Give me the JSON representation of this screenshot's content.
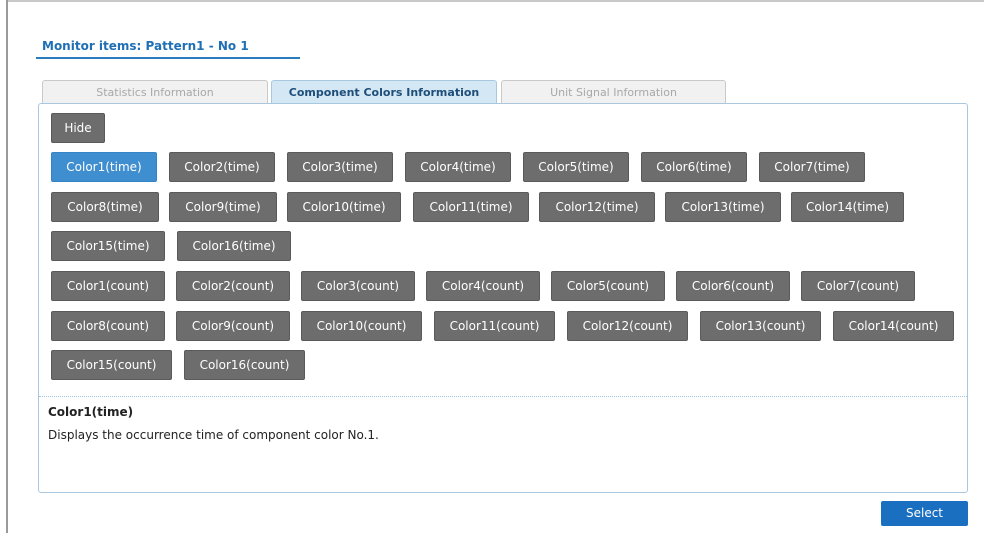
{
  "header": {
    "title": "Monitor items: Pattern1 - No 1"
  },
  "tabs": [
    {
      "label": "Statistics Information",
      "active": false
    },
    {
      "label": "Component Colors Information",
      "active": true
    },
    {
      "label": "Unit Signal Information",
      "active": false
    }
  ],
  "buttons": {
    "hide": "Hide",
    "time": [
      "Color1(time)",
      "Color2(time)",
      "Color3(time)",
      "Color4(time)",
      "Color5(time)",
      "Color6(time)",
      "Color7(time)",
      "Color8(time)",
      "Color9(time)",
      "Color10(time)",
      "Color11(time)",
      "Color12(time)",
      "Color13(time)",
      "Color14(time)",
      "Color15(time)",
      "Color16(time)"
    ],
    "count": [
      "Color1(count)",
      "Color2(count)",
      "Color3(count)",
      "Color4(count)",
      "Color5(count)",
      "Color6(count)",
      "Color7(count)",
      "Color8(count)",
      "Color9(count)",
      "Color10(count)",
      "Color11(count)",
      "Color12(count)",
      "Color13(count)",
      "Color14(count)",
      "Color15(count)",
      "Color16(count)"
    ],
    "selected": "Color1(time)"
  },
  "description": {
    "title": "Color1(time)",
    "text": "Displays the occurrence time of component color No.1."
  },
  "footer": {
    "select_label": "Select"
  },
  "colors": {
    "accent": "#2b7bc0",
    "button_gray": "#6d6d6d",
    "button_selected": "#3f8ed0",
    "select_button": "#1b6fc0"
  }
}
